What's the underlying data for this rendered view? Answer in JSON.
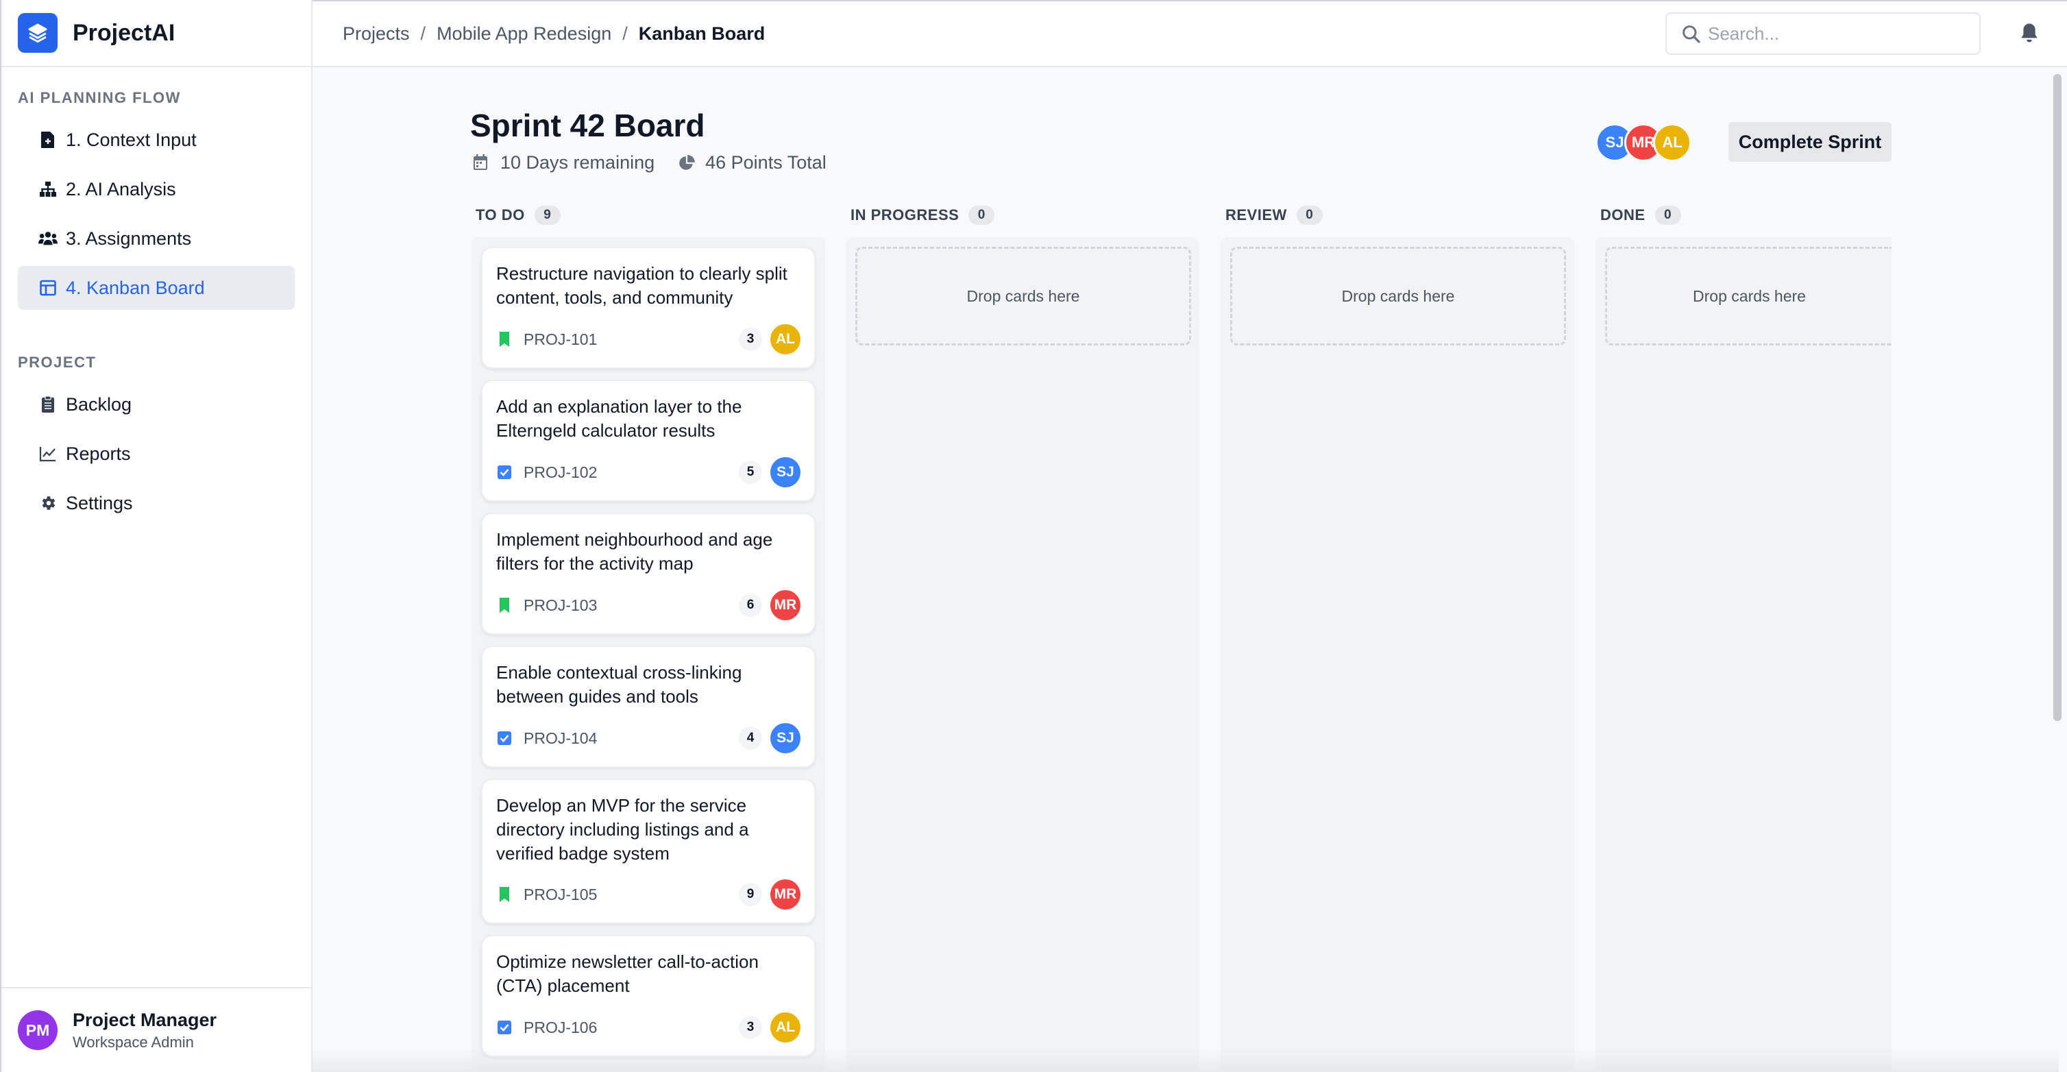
{
  "app": {
    "name": "ProjectAI"
  },
  "sidebar": {
    "flow_heading": "AI PLANNING FLOW",
    "flow_items": [
      {
        "label": "1. Context Input",
        "icon": "file-plus-icon"
      },
      {
        "label": "2. AI Analysis",
        "icon": "sitemap-icon"
      },
      {
        "label": "3. Assignments",
        "icon": "users-icon"
      },
      {
        "label": "4. Kanban Board",
        "icon": "kanban-icon",
        "active": true
      }
    ],
    "project_heading": "PROJECT",
    "project_items": [
      {
        "label": "Backlog",
        "icon": "clipboard-icon"
      },
      {
        "label": "Reports",
        "icon": "line-chart-icon"
      },
      {
        "label": "Settings",
        "icon": "gear-icon"
      }
    ],
    "user": {
      "initials": "PM",
      "name": "Project Manager",
      "role": "Workspace Admin"
    }
  },
  "topbar": {
    "breadcrumbs": [
      "Projects",
      "Mobile App Redesign",
      "Kanban Board"
    ],
    "separator": "/",
    "search_placeholder": "Search..."
  },
  "board": {
    "title": "Sprint 42 Board",
    "days_remaining": "10 Days remaining",
    "points_total": "46 Points Total",
    "team": [
      {
        "initials": "SJ",
        "color": "#3b82f6"
      },
      {
        "initials": "MR",
        "color": "#ef4444"
      },
      {
        "initials": "AL",
        "color": "#eab308"
      }
    ],
    "complete_button": "Complete Sprint",
    "columns": [
      {
        "name": "TO DO",
        "count": "9"
      },
      {
        "name": "IN PROGRESS",
        "count": "0",
        "empty_text": "Drop cards here"
      },
      {
        "name": "REVIEW",
        "count": "0",
        "empty_text": "Drop cards here"
      },
      {
        "name": "DONE",
        "count": "0",
        "empty_text": "Drop cards here"
      }
    ],
    "cards": [
      {
        "title": "Restructure navigation to clearly split content, tools, and community",
        "key": "PROJ-101",
        "type": "story",
        "points": "3",
        "assignee": "AL",
        "assignee_color": "#eab308"
      },
      {
        "title": "Add an explanation layer to the Elterngeld calculator results",
        "key": "PROJ-102",
        "type": "task",
        "points": "5",
        "assignee": "SJ",
        "assignee_color": "#3b82f6"
      },
      {
        "title": "Implement neighbourhood and age filters for the activity map",
        "key": "PROJ-103",
        "type": "story",
        "points": "6",
        "assignee": "MR",
        "assignee_color": "#ef4444"
      },
      {
        "title": "Enable contextual cross-linking between guides and tools",
        "key": "PROJ-104",
        "type": "task",
        "points": "4",
        "assignee": "SJ",
        "assignee_color": "#3b82f6"
      },
      {
        "title": "Develop an MVP for the service directory including listings and a verified badge system",
        "key": "PROJ-105",
        "type": "story",
        "points": "9",
        "assignee": "MR",
        "assignee_color": "#ef4444"
      },
      {
        "title": "Optimize newsletter call-to-action (CTA) placement",
        "key": "PROJ-106",
        "type": "task",
        "points": "3",
        "assignee": "AL",
        "assignee_color": "#eab308"
      }
    ]
  },
  "colors": {
    "accent": "#2563eb",
    "story": "#22c55e",
    "task": "#3b82f6"
  }
}
